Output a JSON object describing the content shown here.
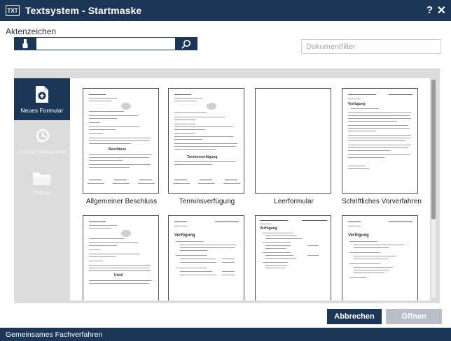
{
  "window": {
    "logo_text": "TXT",
    "title": "Textsystem - Startmaske",
    "help_label": "?",
    "close_label": "✕"
  },
  "search": {
    "label": "Aktenzeichen",
    "value": "",
    "eraser_icon": "eraser-icon",
    "search_icon": "magnifier-icon"
  },
  "filter": {
    "placeholder": "Dokumentfilter",
    "value": ""
  },
  "sidebar": {
    "items": [
      {
        "label": "Neues Formular",
        "icon": "new-document-icon",
        "active": true
      },
      {
        "label": "Zuletzt verwendet",
        "icon": "history-icon",
        "active": false
      },
      {
        "label": "Öffnen",
        "icon": "folder-icon",
        "active": false
      }
    ]
  },
  "templates": [
    {
      "label": "Allgemeiner Beschluss",
      "preview_heading": "Beschluss"
    },
    {
      "label": "Terminsverfügung",
      "preview_heading": "Terminsverfügung"
    },
    {
      "label": "Leerformular",
      "preview_heading": ""
    },
    {
      "label": "Schriftliches Vorverfahren",
      "preview_heading": "Verfügung"
    },
    {
      "label": "",
      "preview_heading": "Urteil"
    },
    {
      "label": "",
      "preview_heading": "Verfügung"
    },
    {
      "label": "",
      "preview_heading": "Verfügung"
    },
    {
      "label": "",
      "preview_heading": "Verfügung"
    }
  ],
  "buttons": {
    "cancel": "Abbrechen",
    "open": "Öffnen"
  },
  "footer": {
    "text": "Gemeinsames Fachverfahren"
  },
  "colors": {
    "primary": "#1c3657",
    "disabled_button": "#b8bfc8",
    "panel_bg": "#dcdcdc"
  }
}
